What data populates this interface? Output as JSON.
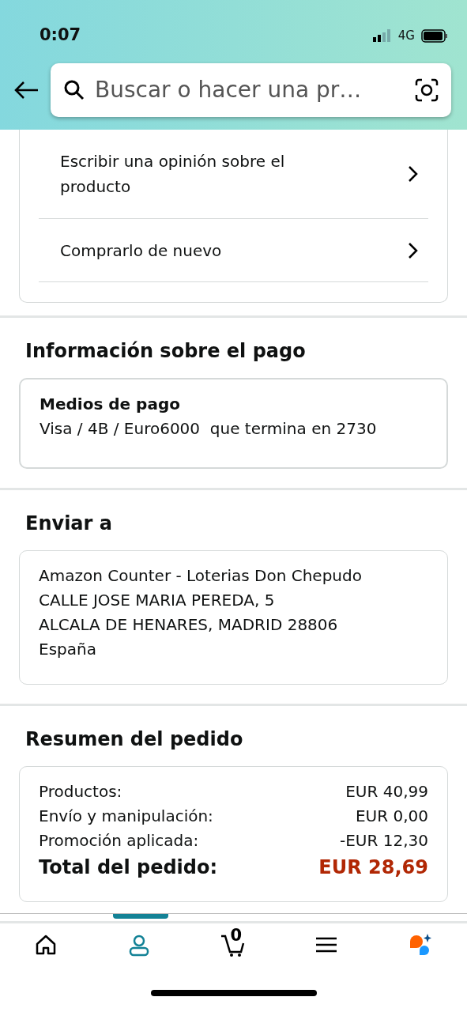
{
  "status_bar": {
    "time": "0:07",
    "network": "4G"
  },
  "search": {
    "placeholder": "Buscar o hacer una pr…"
  },
  "actions": [
    {
      "label": "Escribir una opinión sobre el producto"
    },
    {
      "label": "Comprarlo de nuevo"
    }
  ],
  "payment": {
    "title": "Información sobre el pago",
    "card_title": "Medios de pago",
    "card_text": "Visa / 4B / Euro6000  que termina en 2730"
  },
  "shipping": {
    "title": "Enviar a",
    "lines": [
      "Amazon Counter - Loterias Don Chepudo",
      "CALLE JOSE MARIA PEREDA, 5",
      "ALCALA DE HENARES, MADRID 28806",
      "España"
    ]
  },
  "summary": {
    "title": "Resumen del pedido",
    "rows": [
      {
        "label": "Productos:",
        "value": "EUR 40,99",
        "kind": "line"
      },
      {
        "label": "Envío y manipulación:",
        "value": "EUR 0,00",
        "kind": "line"
      },
      {
        "label": "Promoción aplicada:",
        "value": "-EUR 12,30",
        "kind": "line"
      },
      {
        "label": "Total del pedido:",
        "value": "EUR 28,69",
        "kind": "total"
      }
    ]
  },
  "nav": [
    {
      "kind": "home",
      "selected": false
    },
    {
      "kind": "account",
      "selected": true
    },
    {
      "kind": "cart",
      "selected": false,
      "count": "0"
    },
    {
      "kind": "menu",
      "selected": false
    },
    {
      "kind": "assistant",
      "selected": false
    }
  ]
}
